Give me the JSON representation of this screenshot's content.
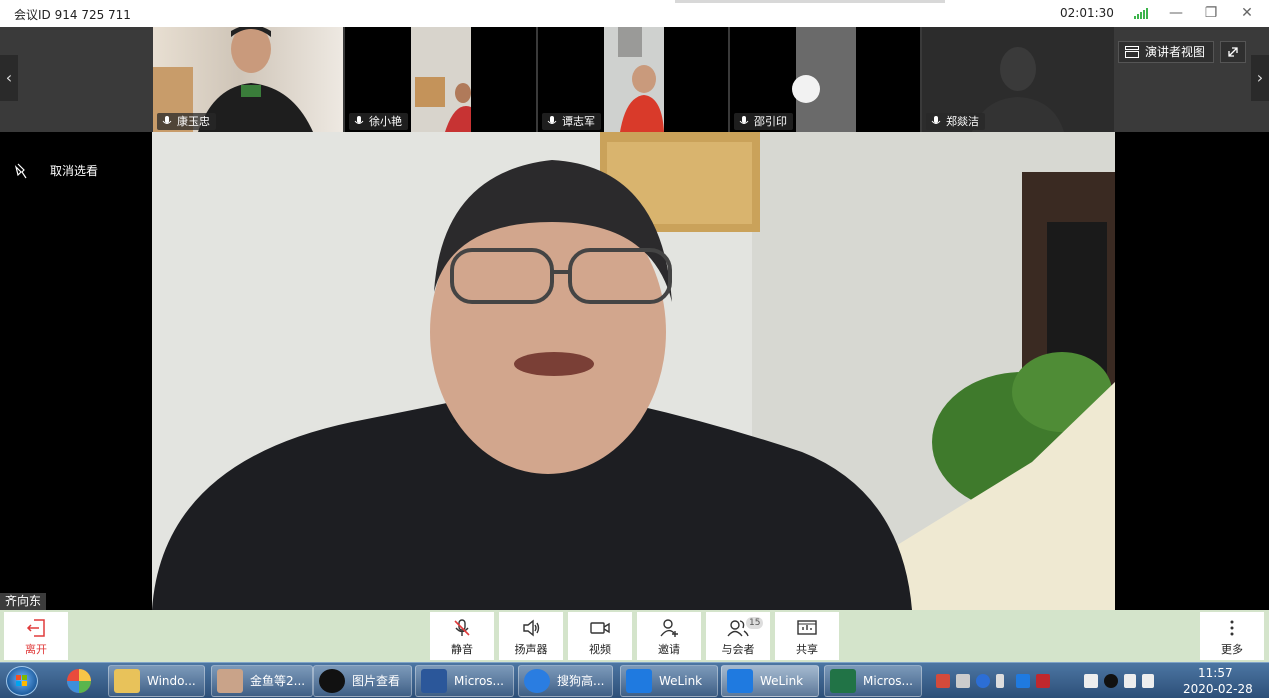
{
  "titlebar": {
    "meeting_id": "会议ID 914 725 711",
    "timer": "02:01:30"
  },
  "participants": [
    {
      "name": "康玉忠"
    },
    {
      "name": "徐小艳"
    },
    {
      "name": "谭志军"
    },
    {
      "name": "邵引印"
    },
    {
      "name": "郑燚洁"
    }
  ],
  "strip": {
    "presenter_view_label": "演讲者视图"
  },
  "left_pane": {
    "unpin_label": "取消选看"
  },
  "main_video": {
    "speaker_name": "齐向东"
  },
  "toolbar": {
    "leave_label": "离开",
    "mute_label": "静音",
    "speaker_label": "扬声器",
    "video_label": "视频",
    "invite_label": "邀请",
    "participants_label": "与会者",
    "participants_count": "15",
    "share_label": "共享",
    "more_label": "更多"
  },
  "taskbar": {
    "items": [
      {
        "label": "Windo..."
      },
      {
        "label": "金鱼等2..."
      },
      {
        "label": "图片查看"
      },
      {
        "label": "Micros..."
      },
      {
        "label": "搜狗高..."
      },
      {
        "label": "WeLink"
      },
      {
        "label": "WeLink"
      },
      {
        "label": "Micros..."
      }
    ],
    "clock_time": "11:57",
    "clock_date": "2020-02-28"
  },
  "colors": {
    "toolbar_bg": "#d4e4cb",
    "leave_red": "#e03b3b",
    "signal_green": "#3cb44b",
    "welink_blue": "#1f7ae0"
  }
}
